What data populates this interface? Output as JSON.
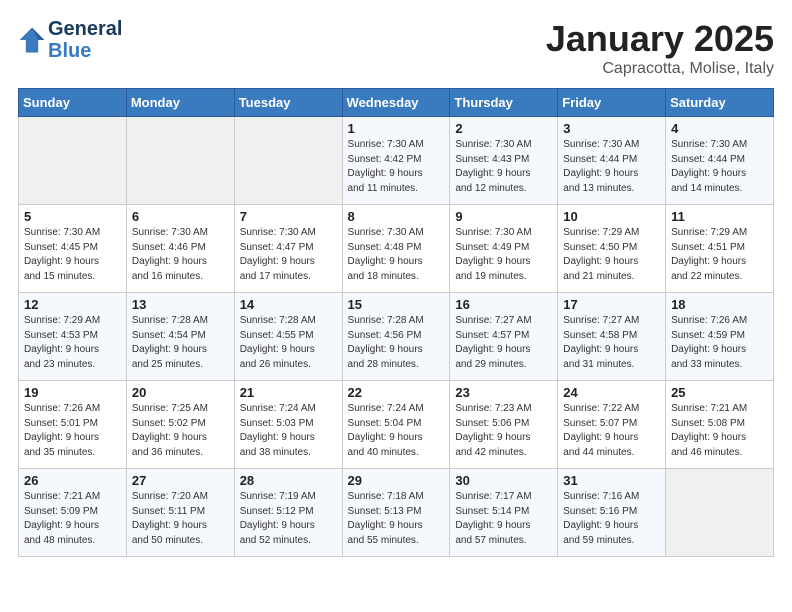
{
  "header": {
    "logo_line1": "General",
    "logo_line2": "Blue",
    "month": "January 2025",
    "location": "Capracotta, Molise, Italy"
  },
  "weekdays": [
    "Sunday",
    "Monday",
    "Tuesday",
    "Wednesday",
    "Thursday",
    "Friday",
    "Saturday"
  ],
  "weeks": [
    [
      {
        "day": "",
        "info": ""
      },
      {
        "day": "",
        "info": ""
      },
      {
        "day": "",
        "info": ""
      },
      {
        "day": "1",
        "info": "Sunrise: 7:30 AM\nSunset: 4:42 PM\nDaylight: 9 hours\nand 11 minutes."
      },
      {
        "day": "2",
        "info": "Sunrise: 7:30 AM\nSunset: 4:43 PM\nDaylight: 9 hours\nand 12 minutes."
      },
      {
        "day": "3",
        "info": "Sunrise: 7:30 AM\nSunset: 4:44 PM\nDaylight: 9 hours\nand 13 minutes."
      },
      {
        "day": "4",
        "info": "Sunrise: 7:30 AM\nSunset: 4:44 PM\nDaylight: 9 hours\nand 14 minutes."
      }
    ],
    [
      {
        "day": "5",
        "info": "Sunrise: 7:30 AM\nSunset: 4:45 PM\nDaylight: 9 hours\nand 15 minutes."
      },
      {
        "day": "6",
        "info": "Sunrise: 7:30 AM\nSunset: 4:46 PM\nDaylight: 9 hours\nand 16 minutes."
      },
      {
        "day": "7",
        "info": "Sunrise: 7:30 AM\nSunset: 4:47 PM\nDaylight: 9 hours\nand 17 minutes."
      },
      {
        "day": "8",
        "info": "Sunrise: 7:30 AM\nSunset: 4:48 PM\nDaylight: 9 hours\nand 18 minutes."
      },
      {
        "day": "9",
        "info": "Sunrise: 7:30 AM\nSunset: 4:49 PM\nDaylight: 9 hours\nand 19 minutes."
      },
      {
        "day": "10",
        "info": "Sunrise: 7:29 AM\nSunset: 4:50 PM\nDaylight: 9 hours\nand 21 minutes."
      },
      {
        "day": "11",
        "info": "Sunrise: 7:29 AM\nSunset: 4:51 PM\nDaylight: 9 hours\nand 22 minutes."
      }
    ],
    [
      {
        "day": "12",
        "info": "Sunrise: 7:29 AM\nSunset: 4:53 PM\nDaylight: 9 hours\nand 23 minutes."
      },
      {
        "day": "13",
        "info": "Sunrise: 7:28 AM\nSunset: 4:54 PM\nDaylight: 9 hours\nand 25 minutes."
      },
      {
        "day": "14",
        "info": "Sunrise: 7:28 AM\nSunset: 4:55 PM\nDaylight: 9 hours\nand 26 minutes."
      },
      {
        "day": "15",
        "info": "Sunrise: 7:28 AM\nSunset: 4:56 PM\nDaylight: 9 hours\nand 28 minutes."
      },
      {
        "day": "16",
        "info": "Sunrise: 7:27 AM\nSunset: 4:57 PM\nDaylight: 9 hours\nand 29 minutes."
      },
      {
        "day": "17",
        "info": "Sunrise: 7:27 AM\nSunset: 4:58 PM\nDaylight: 9 hours\nand 31 minutes."
      },
      {
        "day": "18",
        "info": "Sunrise: 7:26 AM\nSunset: 4:59 PM\nDaylight: 9 hours\nand 33 minutes."
      }
    ],
    [
      {
        "day": "19",
        "info": "Sunrise: 7:26 AM\nSunset: 5:01 PM\nDaylight: 9 hours\nand 35 minutes."
      },
      {
        "day": "20",
        "info": "Sunrise: 7:25 AM\nSunset: 5:02 PM\nDaylight: 9 hours\nand 36 minutes."
      },
      {
        "day": "21",
        "info": "Sunrise: 7:24 AM\nSunset: 5:03 PM\nDaylight: 9 hours\nand 38 minutes."
      },
      {
        "day": "22",
        "info": "Sunrise: 7:24 AM\nSunset: 5:04 PM\nDaylight: 9 hours\nand 40 minutes."
      },
      {
        "day": "23",
        "info": "Sunrise: 7:23 AM\nSunset: 5:06 PM\nDaylight: 9 hours\nand 42 minutes."
      },
      {
        "day": "24",
        "info": "Sunrise: 7:22 AM\nSunset: 5:07 PM\nDaylight: 9 hours\nand 44 minutes."
      },
      {
        "day": "25",
        "info": "Sunrise: 7:21 AM\nSunset: 5:08 PM\nDaylight: 9 hours\nand 46 minutes."
      }
    ],
    [
      {
        "day": "26",
        "info": "Sunrise: 7:21 AM\nSunset: 5:09 PM\nDaylight: 9 hours\nand 48 minutes."
      },
      {
        "day": "27",
        "info": "Sunrise: 7:20 AM\nSunset: 5:11 PM\nDaylight: 9 hours\nand 50 minutes."
      },
      {
        "day": "28",
        "info": "Sunrise: 7:19 AM\nSunset: 5:12 PM\nDaylight: 9 hours\nand 52 minutes."
      },
      {
        "day": "29",
        "info": "Sunrise: 7:18 AM\nSunset: 5:13 PM\nDaylight: 9 hours\nand 55 minutes."
      },
      {
        "day": "30",
        "info": "Sunrise: 7:17 AM\nSunset: 5:14 PM\nDaylight: 9 hours\nand 57 minutes."
      },
      {
        "day": "31",
        "info": "Sunrise: 7:16 AM\nSunset: 5:16 PM\nDaylight: 9 hours\nand 59 minutes."
      },
      {
        "day": "",
        "info": ""
      }
    ]
  ]
}
